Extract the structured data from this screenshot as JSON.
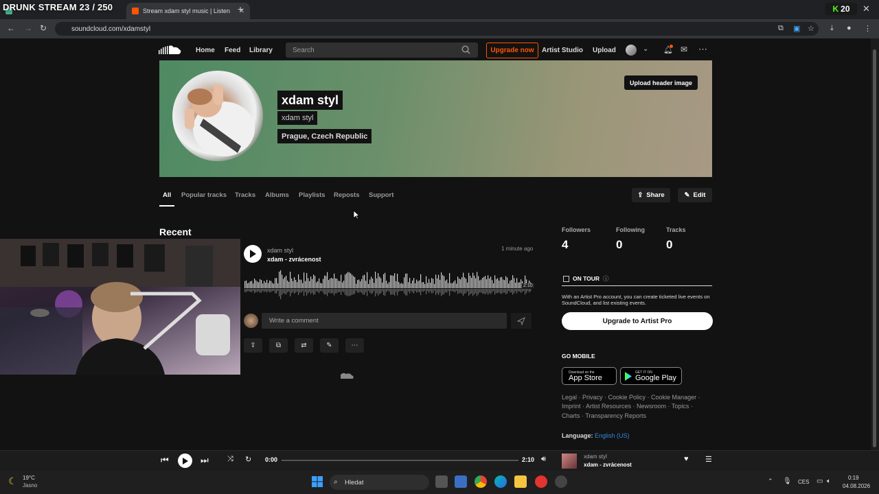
{
  "browser": {
    "stream_overlay": "DRUNK STREAM 23 / 250",
    "tabs": [
      {
        "label": "Stream xdam styl music | Listen",
        "active": true
      }
    ],
    "url": "soundcloud.com/xdamstyl",
    "kick_count": "20"
  },
  "header": {
    "nav": [
      "Home",
      "Feed",
      "Library"
    ],
    "search_placeholder": "Search",
    "upgrade_label": "Upgrade now",
    "artist_studio": "Artist Studio",
    "upload": "Upload",
    "accent_color": "#ff5500"
  },
  "profile": {
    "name": "xdam styl",
    "username": "xdam styl",
    "location": "Prague, Czech Republic",
    "upload_header_label": "Upload header image"
  },
  "tabs": [
    "All",
    "Popular tracks",
    "Tracks",
    "Albums",
    "Playlists",
    "Reposts",
    "Support"
  ],
  "actions": {
    "share": "Share",
    "edit": "Edit"
  },
  "recent": {
    "title": "Recent",
    "track": {
      "artist": "xdam styl",
      "title": "xdam - zvrácenost",
      "posted": "1 minute ago",
      "duration": "2:10"
    },
    "comment_placeholder": "Write a comment"
  },
  "stats": [
    {
      "label": "Followers",
      "value": "4"
    },
    {
      "label": "Following",
      "value": "0"
    },
    {
      "label": "Tracks",
      "value": "0"
    }
  ],
  "tour": {
    "label": "ON TOUR",
    "text": "With an Artist Pro account, you can create ticketed live events on SoundCloud, and list existing events.",
    "cta": "Upgrade to Artist Pro"
  },
  "mobile": {
    "title": "GO MOBILE",
    "app_store_small": "Download on the",
    "app_store": "App Store",
    "google_small": "GET IT ON",
    "google": "Google Play"
  },
  "footer": {
    "line1": "Legal · Privacy · Cookie Policy · Cookie Manager ·",
    "line2": "Imprint · Artist Resources · Newsroom · Topics ·",
    "line3": "Charts · Transparency Reports",
    "language_label": "Language:",
    "language_value": "English (US)"
  },
  "player": {
    "current": "0:00",
    "duration": "2:10",
    "artist": "xdam styl",
    "title": "xdam - zvrácenost",
    "progress": 0
  },
  "taskbar": {
    "temp": "19°C",
    "weather": "Jasno",
    "search": "Hledat",
    "lang": "CES",
    "time": "0:19",
    "date": "04.08.2026"
  }
}
